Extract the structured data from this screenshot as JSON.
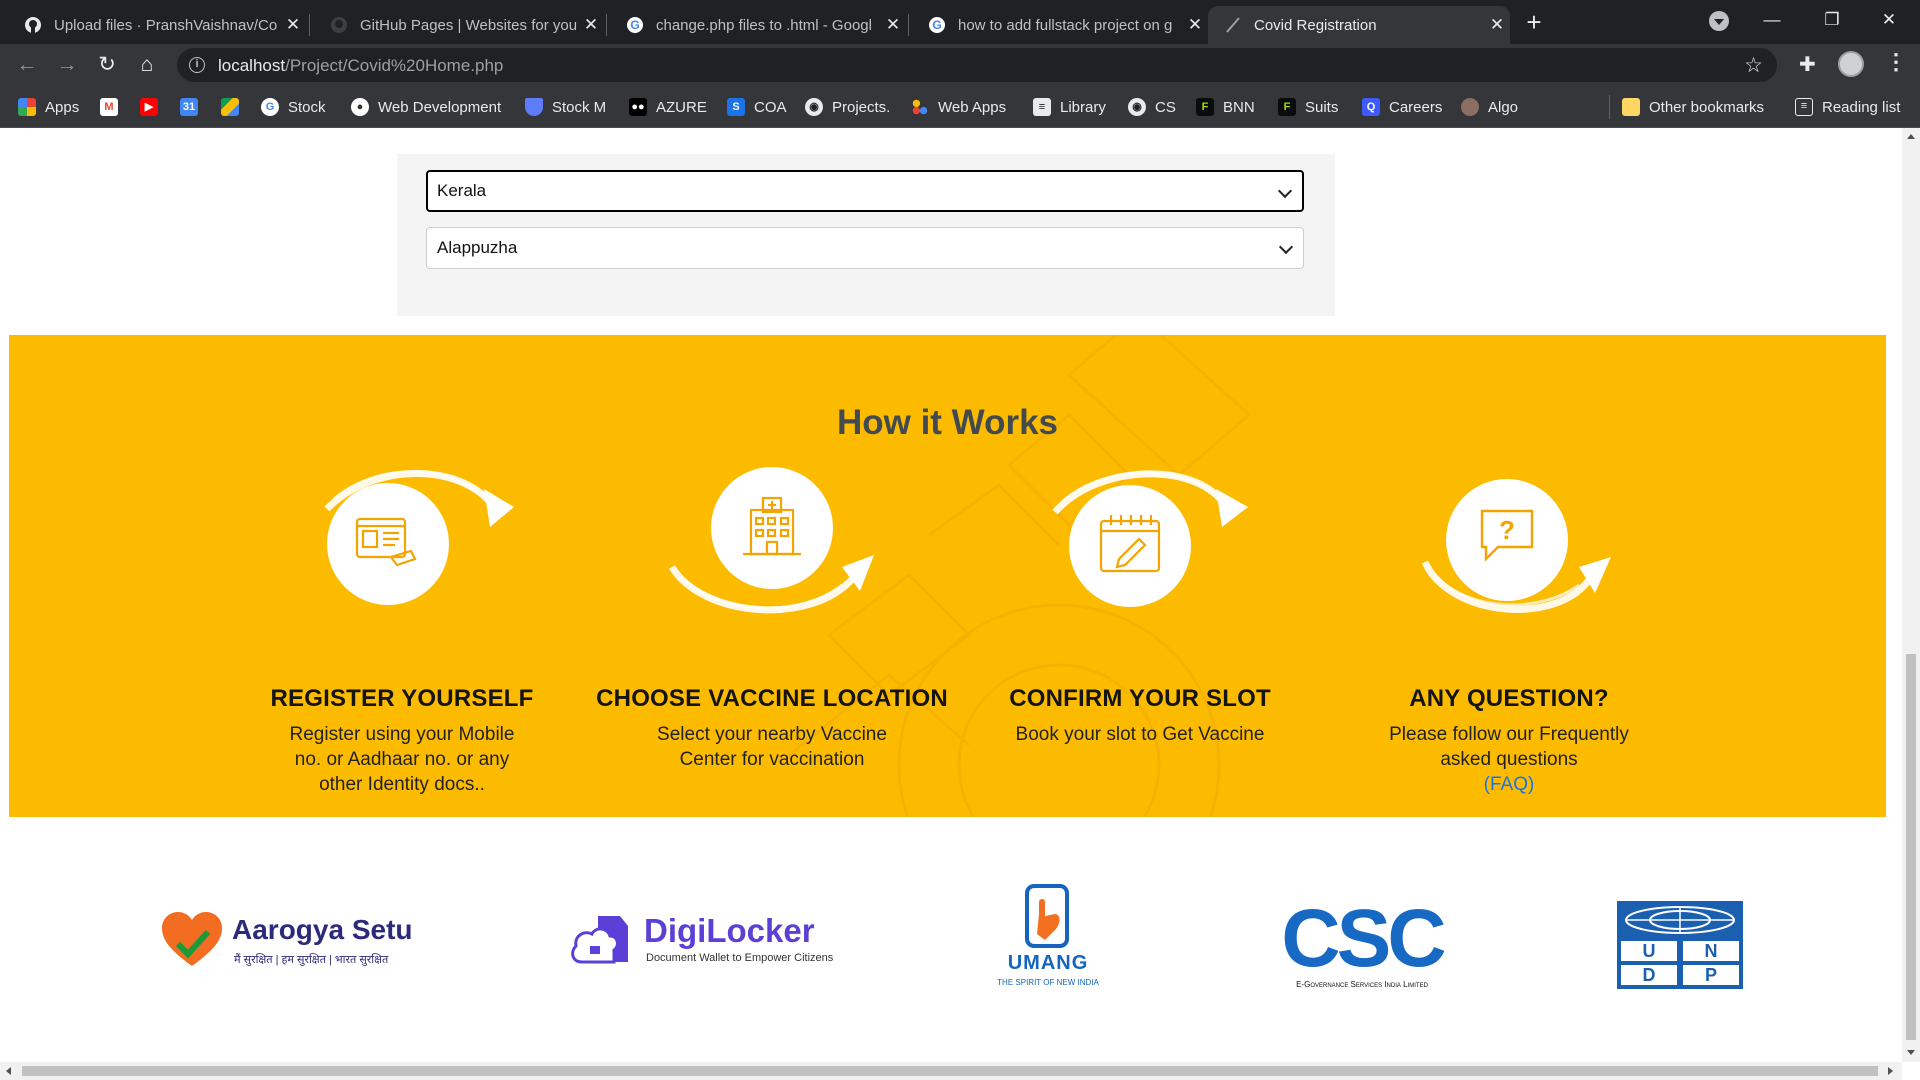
{
  "browser": {
    "tabs": [
      {
        "title": "Upload files · PranshVaishnav/Co",
        "icon": "github-icon",
        "active": false
      },
      {
        "title": "GitHub Pages | Websites for you",
        "icon": "github-icon",
        "active": false
      },
      {
        "title": "change.php files to .html - Googl",
        "icon": "google-icon",
        "active": false
      },
      {
        "title": "how to add fullstack project on g",
        "icon": "google-icon",
        "active": false
      },
      {
        "title": "Covid Registration",
        "icon": "feather-icon",
        "active": true
      }
    ],
    "url_host": "localhost",
    "url_path": "/Project/Covid%20Home.php",
    "bookmarks": [
      {
        "label": "Apps",
        "icon": "apps-grid-icon"
      },
      {
        "label": "",
        "icon": "gmail-icon"
      },
      {
        "label": "",
        "icon": "youtube-icon"
      },
      {
        "label": "",
        "icon": "calendar-icon"
      },
      {
        "label": "",
        "icon": "drive-icon"
      },
      {
        "label": "Stock",
        "icon": "google-icon"
      },
      {
        "label": "Web Development",
        "icon": "bookmark-icon"
      },
      {
        "label": "Stock M",
        "icon": "shield-icon"
      },
      {
        "label": "AZURE",
        "icon": "medium-icon"
      },
      {
        "label": "COA",
        "icon": "s-icon"
      },
      {
        "label": "Projects.",
        "icon": "github-icon"
      },
      {
        "label": "Web Apps",
        "icon": "dots-icon"
      },
      {
        "label": "Library",
        "icon": "book-icon"
      },
      {
        "label": "CS",
        "icon": "github-icon"
      },
      {
        "label": "BNN",
        "icon": "f-icon"
      },
      {
        "label": "Suits",
        "icon": "f-icon"
      },
      {
        "label": "Careers",
        "icon": "q-icon"
      },
      {
        "label": "Algo",
        "icon": "emblem-icon"
      }
    ],
    "other_bookmarks": "Other bookmarks",
    "reading_list": "Reading list"
  },
  "form": {
    "state": "Kerala",
    "district": "Alappuzha"
  },
  "how_it_works": {
    "title": "How it Works",
    "steps": [
      {
        "heading": "REGISTER YOURSELF",
        "desc": "Register using your Mobile no. or Aadhaar no. or any other Identity docs..",
        "icon": "id-card-icon"
      },
      {
        "heading": "CHOOSE VACCINE LOCATION",
        "desc": "Select your nearby Vaccine Center for vaccination",
        "icon": "hospital-icon"
      },
      {
        "heading": "CONFIRM YOUR SLOT",
        "desc": "Book your slot to Get Vaccine",
        "icon": "calendar-icon"
      },
      {
        "heading": "ANY QUESTION?",
        "desc": "Please follow our Frequently asked questions",
        "link": "(FAQ)",
        "icon": "question-bubble-icon"
      }
    ]
  },
  "partners": {
    "aarogya_name": "Aarogya Setu",
    "aarogya_tag": "मैं सुरक्षित | हम सुरक्षित | भारत सुरक्षित",
    "digilocker_name": "DigiLocker",
    "digilocker_tag": "Document Wallet to Empower Citizens",
    "umang_name": "UMANG",
    "umang_tag": "THE SPIRIT OF NEW INDIA",
    "csc_name": "CSC",
    "csc_tag": "E-Governance Services India Limited",
    "undp_letters": [
      "U",
      "N",
      "D",
      "P"
    ]
  },
  "colors": {
    "how_bg": "#fdbb00",
    "title_text": "#424a4f",
    "link": "#1a73e8"
  }
}
